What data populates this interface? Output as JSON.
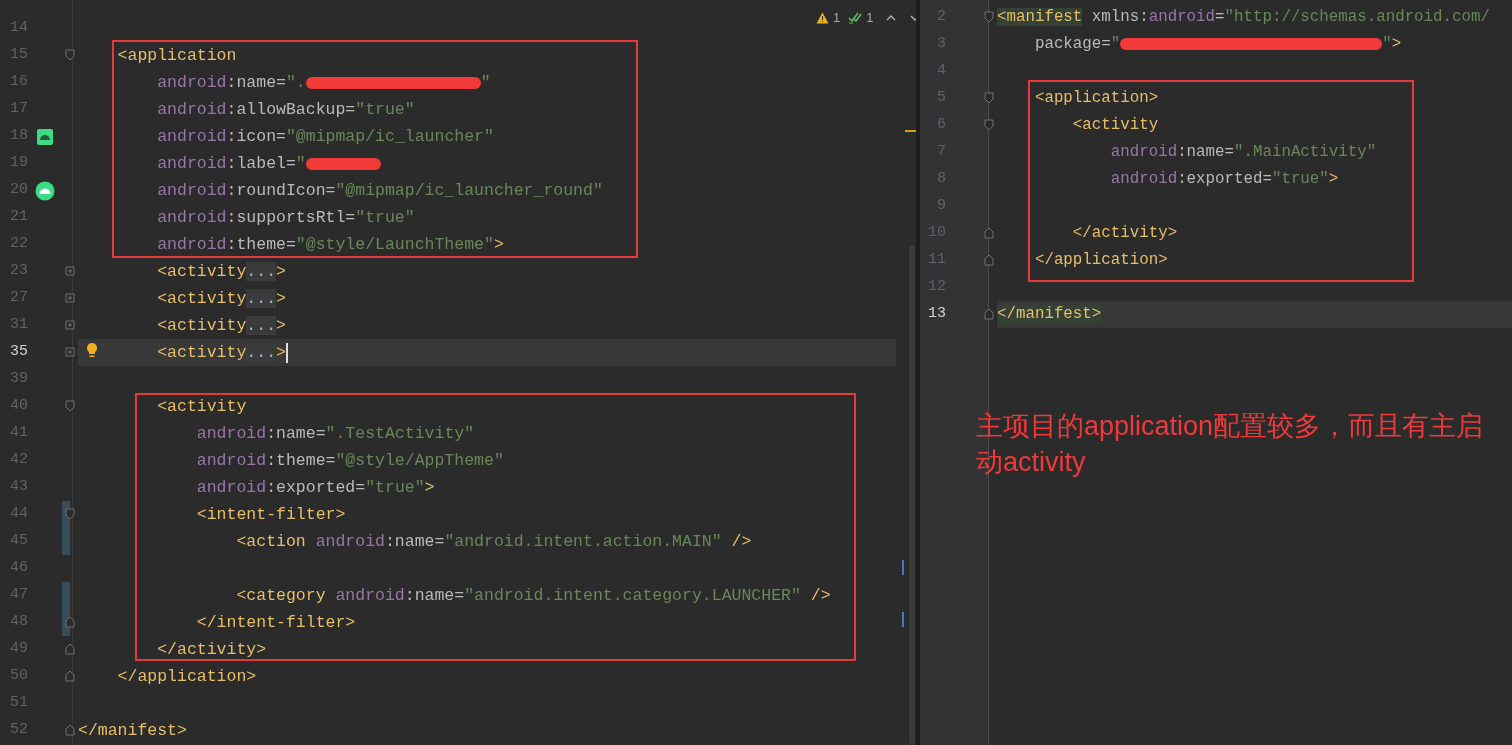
{
  "left_editor": {
    "inspections": {
      "warnings": "1",
      "checks": "1"
    },
    "lines": [
      {
        "number": "14",
        "current": false,
        "changed": false
      },
      {
        "number": "15",
        "current": false,
        "changed": false,
        "markers": [
          {
            "kind": "fold_start"
          }
        ],
        "tokens": [
          {
            "kind": "tag",
            "text": "    <application"
          }
        ]
      },
      {
        "number": "16",
        "current": false,
        "changed": false,
        "tokens": [
          {
            "kind": "ns",
            "text": "        android"
          },
          {
            "kind": "attr",
            "text": ":name="
          },
          {
            "kind": "value",
            "text": "\"."
          },
          {
            "kind": "redacted"
          },
          {
            "kind": "value",
            "text": "\""
          }
        ]
      },
      {
        "number": "17",
        "current": false,
        "changed": false,
        "tokens": [
          {
            "kind": "ns",
            "text": "        android"
          },
          {
            "kind": "attr",
            "text": ":allowBackup="
          },
          {
            "kind": "value",
            "text": "\"true\""
          }
        ]
      },
      {
        "number": "18",
        "current": false,
        "changed": false,
        "markers": [
          {
            "kind": "android"
          }
        ],
        "tokens": [
          {
            "kind": "ns",
            "text": "        android"
          },
          {
            "kind": "attr",
            "text": ":icon="
          },
          {
            "kind": "value",
            "text": "\"@mipmap/ic_launcher\""
          }
        ]
      },
      {
        "number": "19",
        "current": false,
        "changed": false,
        "tokens": [
          {
            "kind": "ns",
            "text": "        android"
          },
          {
            "kind": "attr",
            "text": ":label="
          },
          {
            "kind": "value",
            "text": "\""
          },
          {
            "kind": "redacted"
          }
        ]
      },
      {
        "number": "20",
        "current": false,
        "changed": false,
        "markers": [
          {
            "kind": "android_round"
          }
        ],
        "tokens": [
          {
            "kind": "ns",
            "text": "        android"
          },
          {
            "kind": "attr",
            "text": ":roundIcon="
          },
          {
            "kind": "value",
            "text": "\"@mipmap/ic_launcher_round\""
          }
        ]
      },
      {
        "number": "21",
        "current": false,
        "changed": false,
        "tokens": [
          {
            "kind": "ns",
            "text": "        android"
          },
          {
            "kind": "attr",
            "text": ":supportsRtl="
          },
          {
            "kind": "value",
            "text": "\"true\""
          }
        ]
      },
      {
        "number": "22",
        "current": false,
        "changed": false,
        "tokens": [
          {
            "kind": "ns",
            "text": "        android"
          },
          {
            "kind": "attr",
            "text": ":theme="
          },
          {
            "kind": "value",
            "text": "\"@style/LaunchTheme\""
          },
          {
            "kind": "tag",
            "text": ">"
          }
        ]
      },
      {
        "number": "23",
        "current": false,
        "changed": false,
        "markers": [
          {
            "kind": "fold_collapsed"
          }
        ],
        "tokens": [
          {
            "kind": "tag",
            "text": "        <activity"
          },
          {
            "kind": "folded",
            "text": "..."
          },
          {
            "kind": "tag",
            "text": ">"
          }
        ]
      },
      {
        "number": "27",
        "current": false,
        "changed": false,
        "markers": [
          {
            "kind": "fold_collapsed"
          }
        ],
        "tokens": [
          {
            "kind": "tag",
            "text": "        <activity"
          },
          {
            "kind": "folded",
            "text": "..."
          },
          {
            "kind": "tag",
            "text": ">"
          }
        ]
      },
      {
        "number": "31",
        "current": false,
        "changed": false,
        "markers": [
          {
            "kind": "fold_collapsed"
          }
        ],
        "tokens": [
          {
            "kind": "tag",
            "text": "        <activity"
          },
          {
            "kind": "folded",
            "text": "..."
          },
          {
            "kind": "tag",
            "text": ">"
          }
        ]
      },
      {
        "number": "35",
        "current": true,
        "changed": false,
        "markers": [
          {
            "kind": "fold_collapsed"
          },
          {
            "kind": "bulb"
          }
        ],
        "tokens": [
          {
            "kind": "tag",
            "text": "        <activity"
          },
          {
            "kind": "folded",
            "text": "..."
          },
          {
            "kind": "tag",
            "text": ">"
          },
          {
            "kind": "caret"
          }
        ]
      },
      {
        "number": "39",
        "current": false,
        "changed": false
      },
      {
        "number": "40",
        "current": false,
        "changed": false,
        "markers": [
          {
            "kind": "fold_start"
          }
        ],
        "tokens": [
          {
            "kind": "tag",
            "text": "        <activity"
          }
        ]
      },
      {
        "number": "41",
        "current": false,
        "changed": false,
        "tokens": [
          {
            "kind": "ns",
            "text": "            android"
          },
          {
            "kind": "attr",
            "text": ":name="
          },
          {
            "kind": "value",
            "text": "\".TestActivity\""
          }
        ]
      },
      {
        "number": "42",
        "current": false,
        "changed": false,
        "tokens": [
          {
            "kind": "ns",
            "text": "            android"
          },
          {
            "kind": "attr",
            "text": ":theme="
          },
          {
            "kind": "value",
            "text": "\"@style/AppTheme\""
          }
        ]
      },
      {
        "number": "43",
        "current": false,
        "changed": false,
        "tokens": [
          {
            "kind": "ns",
            "text": "            android"
          },
          {
            "kind": "attr",
            "text": ":exported="
          },
          {
            "kind": "value",
            "text": "\"true\""
          },
          {
            "kind": "tag",
            "text": ">"
          }
        ]
      },
      {
        "number": "44",
        "current": false,
        "changed": true,
        "markers": [
          {
            "kind": "fold_start"
          }
        ],
        "tokens": [
          {
            "kind": "tag",
            "text": "            <intent-filter>"
          }
        ]
      },
      {
        "number": "45",
        "current": false,
        "changed": true,
        "tokens": [
          {
            "kind": "tag",
            "text": "                <action "
          },
          {
            "kind": "ns",
            "text": "android"
          },
          {
            "kind": "attr",
            "text": ":name="
          },
          {
            "kind": "value",
            "text": "\"android.intent.action.MAIN\""
          },
          {
            "kind": "tag",
            "text": " />"
          }
        ]
      },
      {
        "number": "46",
        "current": false,
        "changed": false
      },
      {
        "number": "47",
        "current": false,
        "changed": true,
        "tokens": [
          {
            "kind": "tag",
            "text": "                <category "
          },
          {
            "kind": "ns",
            "text": "android"
          },
          {
            "kind": "attr",
            "text": ":name="
          },
          {
            "kind": "value",
            "text": "\"android.intent.category.LAUNCHER\""
          },
          {
            "kind": "tag",
            "text": " />"
          }
        ]
      },
      {
        "number": "48",
        "current": false,
        "changed": true,
        "markers": [
          {
            "kind": "fold_end"
          }
        ],
        "tokens": [
          {
            "kind": "tag",
            "text": "            </intent-filter>"
          }
        ]
      },
      {
        "number": "49",
        "current": false,
        "changed": false,
        "markers": [
          {
            "kind": "fold_end"
          }
        ],
        "tokens": [
          {
            "kind": "tag",
            "text": "        </activity>"
          }
        ]
      },
      {
        "number": "50",
        "current": false,
        "changed": false,
        "markers": [
          {
            "kind": "fold_end"
          }
        ],
        "tokens": [
          {
            "kind": "tag",
            "text": "    </application>"
          }
        ]
      },
      {
        "number": "51",
        "current": false,
        "changed": false
      },
      {
        "number": "52",
        "current": false,
        "changed": false,
        "markers": [
          {
            "kind": "fold_end"
          }
        ],
        "tokens": [
          {
            "kind": "tag",
            "text": "</manifest>"
          }
        ]
      }
    ]
  },
  "right_editor": {
    "annotation": "主项目的application配置较多，而且有主启动activity",
    "lines": [
      {
        "number": "2",
        "current": false,
        "markers": [
          {
            "kind": "fold_start"
          }
        ],
        "tokens": [
          {
            "kind": "matched_tag",
            "text": "<manifest"
          },
          {
            "kind": "attr",
            "text": " xmlns:"
          },
          {
            "kind": "ns",
            "text": "android"
          },
          {
            "kind": "attr",
            "text": "="
          },
          {
            "kind": "value",
            "text": "\"http://schemas.android.com/"
          }
        ]
      },
      {
        "number": "3",
        "current": false,
        "tokens": [
          {
            "kind": "attr",
            "text": "    package="
          },
          {
            "kind": "value",
            "text": "\""
          },
          {
            "kind": "redacted"
          },
          {
            "kind": "value",
            "text": "\""
          },
          {
            "kind": "tag",
            "text": ">"
          }
        ]
      },
      {
        "number": "4",
        "current": false
      },
      {
        "number": "5",
        "current": false,
        "markers": [
          {
            "kind": "fold_start"
          }
        ],
        "tokens": [
          {
            "kind": "tag",
            "text": "    <application>"
          }
        ]
      },
      {
        "number": "6",
        "current": false,
        "markers": [
          {
            "kind": "fold_start"
          }
        ],
        "tokens": [
          {
            "kind": "tag",
            "text": "        <activity"
          }
        ]
      },
      {
        "number": "7",
        "current": false,
        "tokens": [
          {
            "kind": "ns",
            "text": "            android"
          },
          {
            "kind": "attr",
            "text": ":name="
          },
          {
            "kind": "value",
            "text": "\".MainActivity\""
          }
        ]
      },
      {
        "number": "8",
        "current": false,
        "tokens": [
          {
            "kind": "ns",
            "text": "            android"
          },
          {
            "kind": "attr",
            "text": ":exported="
          },
          {
            "kind": "value",
            "text": "\"true\""
          },
          {
            "kind": "tag",
            "text": ">"
          }
        ]
      },
      {
        "number": "9",
        "current": false
      },
      {
        "number": "10",
        "current": false,
        "markers": [
          {
            "kind": "fold_end"
          }
        ],
        "tokens": [
          {
            "kind": "tag",
            "text": "        </activity>"
          }
        ]
      },
      {
        "number": "11",
        "current": false,
        "markers": [
          {
            "kind": "fold_end"
          }
        ],
        "tokens": [
          {
            "kind": "tag",
            "text": "    </application>"
          }
        ]
      },
      {
        "number": "12",
        "current": false
      },
      {
        "number": "13",
        "current": true,
        "markers": [
          {
            "kind": "fold_end"
          }
        ],
        "tokens": [
          {
            "kind": "matched_tag",
            "text": "</manifest>"
          }
        ]
      }
    ]
  }
}
